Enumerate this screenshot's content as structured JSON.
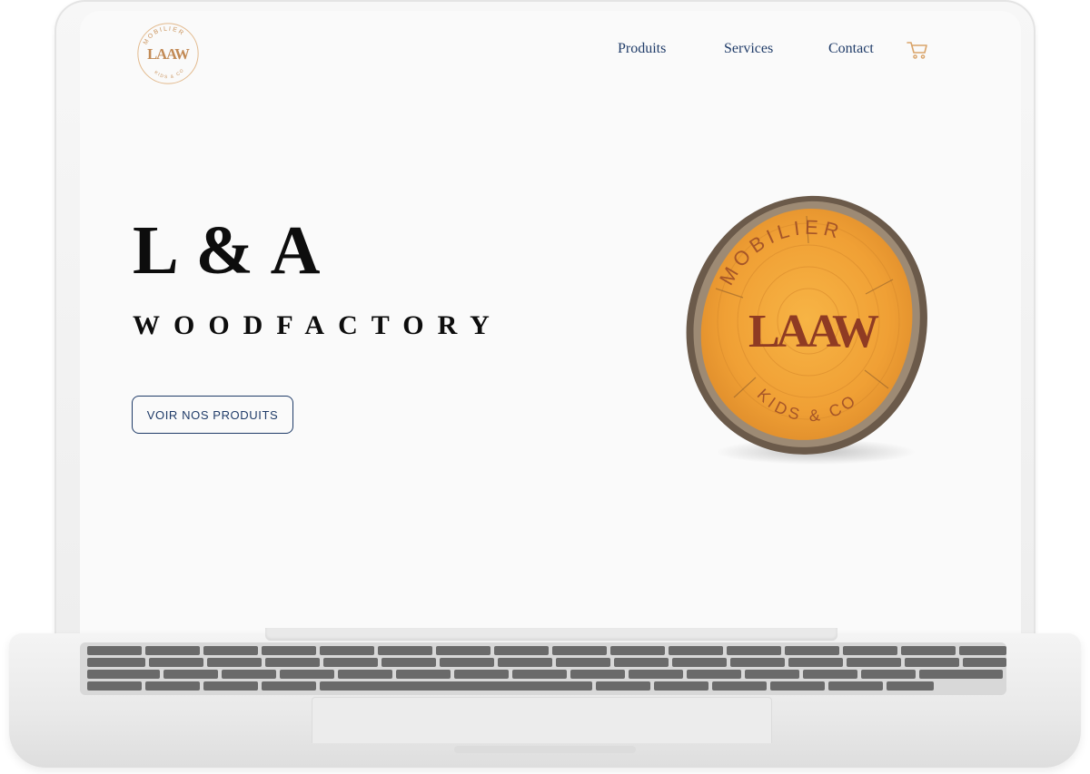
{
  "header": {
    "logo_alt": "L&A Wood — Mobilier Kids & Co",
    "logo_text": {
      "top": "MOBILIER",
      "monogram": "LAAW",
      "bottom": "KIDS & CO"
    },
    "nav": [
      {
        "label": "Produits"
      },
      {
        "label": "Services"
      },
      {
        "label": "Contact"
      }
    ],
    "cart_icon": "shopping-cart-icon"
  },
  "hero": {
    "title": "L & A",
    "subtitle": "WOODFACTORY",
    "cta_label": "VOIR NOS PRODUITS",
    "image_text": {
      "top": "MOBILIER",
      "monogram": "LAAW",
      "bottom": "KIDS & CO"
    }
  },
  "colors": {
    "nav_text": "#1f3b68",
    "title_text": "#0d0d0d",
    "accent_gold": "#d9a46a",
    "wood_orange": "#f2a43a",
    "wood_brand": "#8f3b23"
  }
}
